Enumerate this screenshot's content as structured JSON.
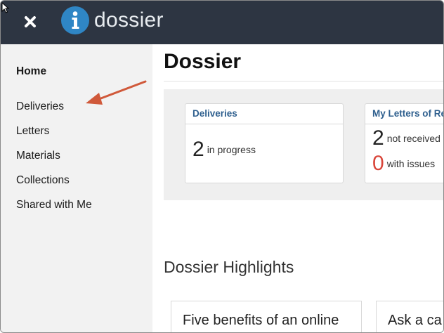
{
  "header": {
    "brand": "dossier",
    "logo_letter": "i",
    "close_icon": "close-x-icon",
    "colors": {
      "background": "#2d3542",
      "logo": "#2f86c5",
      "text": "#e7ebef"
    }
  },
  "sidebar": {
    "items": [
      {
        "label": "Home",
        "active": true
      },
      {
        "label": "Deliveries"
      },
      {
        "label": "Letters"
      },
      {
        "label": "Materials"
      },
      {
        "label": "Collections"
      },
      {
        "label": "Shared with Me"
      }
    ]
  },
  "main": {
    "title": "Dossier",
    "cards": [
      {
        "title": "Deliveries",
        "stats": [
          {
            "value": "2",
            "label": "in progress"
          }
        ]
      },
      {
        "title": "My Letters of Re",
        "stats": [
          {
            "value": "2",
            "label": "not received"
          },
          {
            "value": "0",
            "label": "with issues",
            "color": "#d9453a"
          }
        ]
      }
    ],
    "highlights_title": "Dossier Highlights",
    "highlights": [
      {
        "title": "Five benefits of an online"
      },
      {
        "title": "Ask a ca"
      }
    ]
  },
  "annotation": {
    "type": "arrow",
    "color": "#d0593a",
    "points_to": "Deliveries"
  }
}
